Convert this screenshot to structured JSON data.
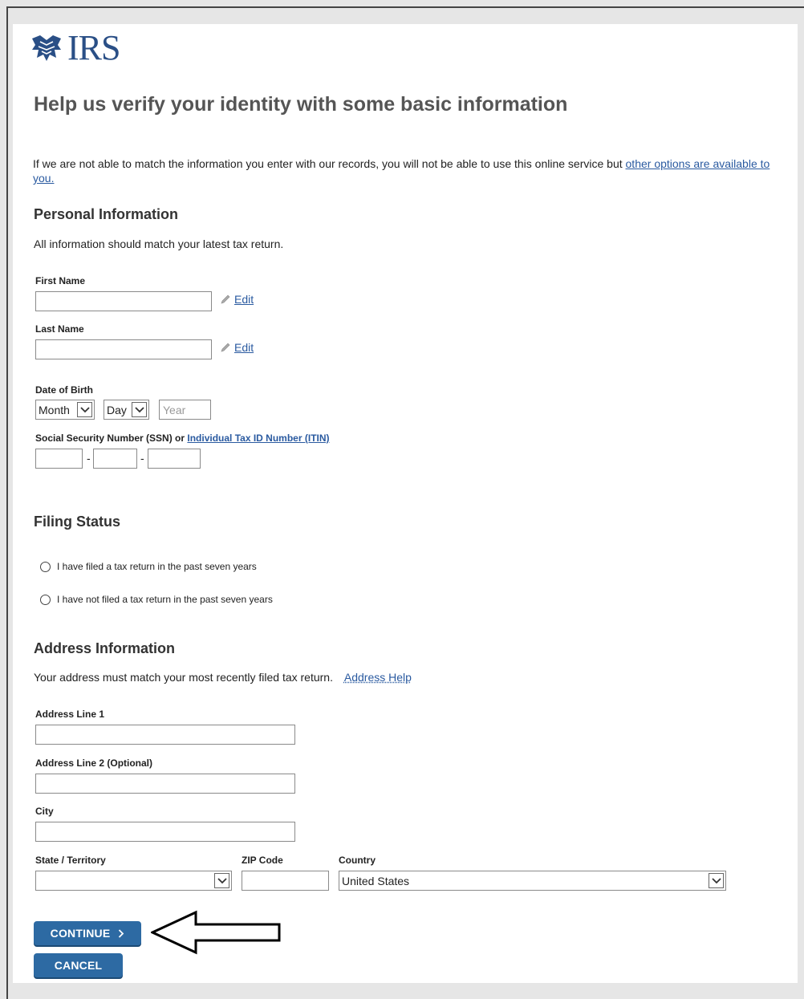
{
  "brand": {
    "name": "IRS"
  },
  "page": {
    "title": "Help us verify your identity with some basic information",
    "intro_text": "If we are not able to match the information you enter with our records, you will not be able to use this online service but ",
    "intro_link": "other options are available to you."
  },
  "personal": {
    "heading": "Personal Information",
    "note": "All information should match your latest tax return.",
    "first_name_label": "First Name",
    "last_name_label": "Last Name",
    "edit_label": "Edit",
    "dob_label": "Date of Birth",
    "month_value": "Month",
    "day_value": "Day",
    "year_placeholder": "Year",
    "ssn_label": "Social Security Number (SSN) or ",
    "itin_link": "Individual Tax ID Number (ITIN)",
    "dash": "-"
  },
  "filing": {
    "heading": "Filing Status",
    "option_filed": "I have filed a tax return in the past seven years",
    "option_not_filed": "I have not filed a tax return in the past seven years"
  },
  "address": {
    "heading": "Address Information",
    "note": "Your address must match your most recently filed tax return.",
    "help_link": "Address Help",
    "line1_label": "Address Line 1",
    "line2_label": "Address Line 2 (Optional)",
    "city_label": "City",
    "state_label": "State / Territory",
    "state_value": "",
    "zip_label": "ZIP Code",
    "country_label": "Country",
    "country_value": "United States"
  },
  "buttons": {
    "continue_label": "CONTINUE",
    "cancel_label": "CANCEL"
  },
  "icons": {
    "pencil": "pencil-icon",
    "chevron_down": "chevron-down-icon",
    "chevron_right": "chevron-right-icon",
    "arrow": "left-arrow-annotation"
  },
  "colors": {
    "brand_blue": "#2a4f86",
    "button_blue": "#2d6aa3",
    "link_blue": "#2a5aa0"
  }
}
